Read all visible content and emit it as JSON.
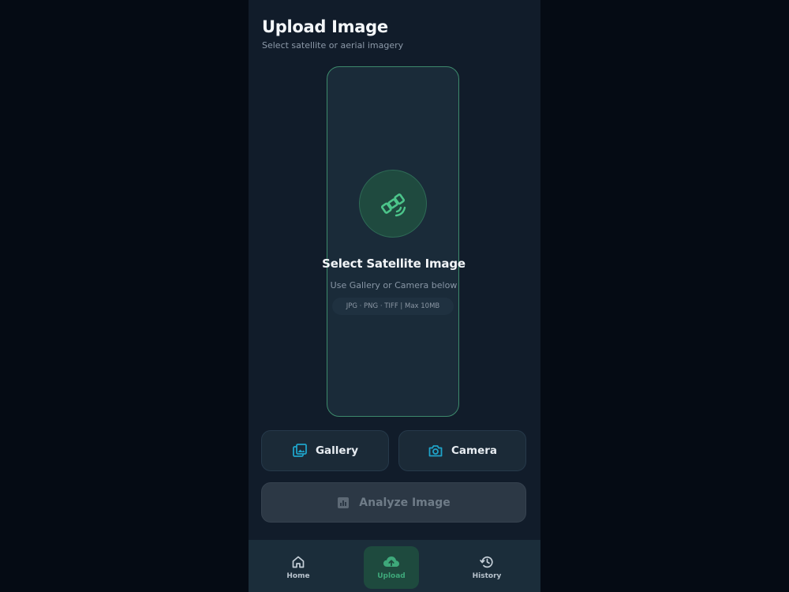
{
  "header": {
    "title": "Upload Image",
    "subtitle": "Select satellite or aerial imagery"
  },
  "dropzone": {
    "icon": "satellite-icon",
    "title": "Select Satellite Image",
    "subtitle": "Use Gallery or Camera below",
    "formats": "JPG · PNG · TIFF  |  Max 10MB"
  },
  "actions": {
    "gallery_label": "Gallery",
    "gallery_icon": "gallery-icon",
    "camera_label": "Camera",
    "camera_icon": "camera-icon",
    "analyze_label": "Analyze Image",
    "analyze_icon": "analyze-icon"
  },
  "nav": {
    "items": [
      {
        "label": "Home",
        "icon": "home-icon"
      },
      {
        "label": "Upload",
        "icon": "cloud-upload-icon",
        "active": true
      },
      {
        "label": "History",
        "icon": "history-icon"
      }
    ]
  },
  "colors": {
    "accent_green": "#3ea87a",
    "accent_teal": "#1fa3c9",
    "background": "#111c2a",
    "page_background": "#050b14"
  }
}
